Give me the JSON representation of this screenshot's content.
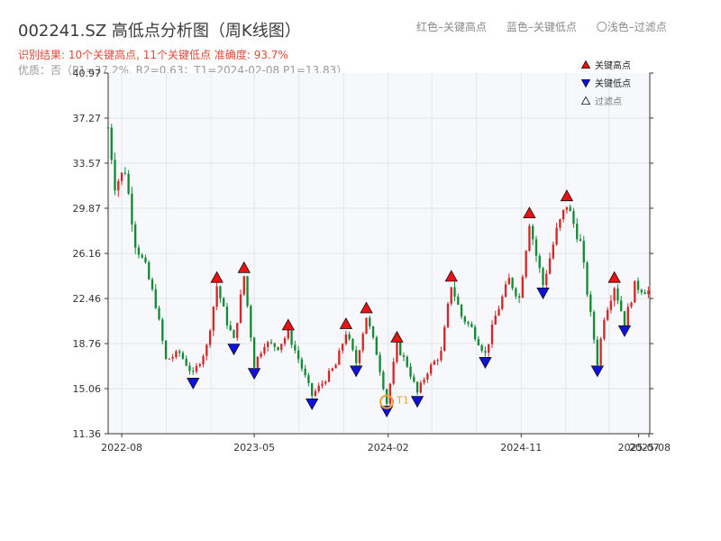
{
  "header": {
    "title": "002241.SZ 高低点分析图（周K线图）",
    "legend_red": "红色–关键高点",
    "legend_blue": "蓝色–关键低点",
    "legend_gray": "〇浅色–过滤点",
    "result_line": "识别结果: 10个关键高点, 11个关键低点  准确度: 93.7%",
    "quality_line": "优质：否（P1=37.2%, R2=0.63；T1=2024-02-08 P1=13.83）"
  },
  "chart_data": {
    "type": "candlestick",
    "title": "002241.SZ 高低点分析图（周K线图）",
    "x_range": [
      "2022-07-04",
      "2025-07-24"
    ],
    "x_ticks": [
      {
        "date": "2022-08-01",
        "label": "2022-08"
      },
      {
        "date": "2023-05-01",
        "label": "2023-05"
      },
      {
        "date": "2024-02-01",
        "label": "2024-02"
      },
      {
        "date": "2024-11-01",
        "label": "2024-11"
      },
      {
        "date": "2025-07-01",
        "label": "2025-07"
      },
      {
        "date": "2025-08-01",
        "label": "2025-08"
      }
    ],
    "ylim": [
      11.36,
      40.97
    ],
    "y_ticks": [
      11.36,
      15.06,
      18.76,
      22.46,
      26.16,
      29.87,
      33.57,
      37.27,
      40.97
    ],
    "grid": true,
    "colors": {
      "up": "#d62728",
      "down": "#138a36",
      "high_marker": "#ee1111",
      "low_marker": "#1111dd",
      "t1_marker": "#f0a030",
      "grid": "#e3e6ea",
      "plot_bg": "#f6f8fb"
    },
    "price_path": [
      [
        "2022-07-04",
        36.5
      ],
      [
        "2022-07-18",
        31.8
      ],
      [
        "2022-08-08",
        33.0
      ],
      [
        "2022-08-29",
        27.0
      ],
      [
        "2022-09-19",
        25.0
      ],
      [
        "2022-10-10",
        22.0
      ],
      [
        "2022-10-31",
        17.4
      ],
      [
        "2022-11-28",
        18.0
      ],
      [
        "2022-12-26",
        16.2
      ],
      [
        "2023-01-23",
        18.5
      ],
      [
        "2023-02-13",
        23.5
      ],
      [
        "2023-03-06",
        20.5
      ],
      [
        "2023-03-20",
        19.0
      ],
      [
        "2023-04-10",
        24.3
      ],
      [
        "2023-05-01",
        17.0
      ],
      [
        "2023-05-22",
        18.8
      ],
      [
        "2023-06-19",
        18.5
      ],
      [
        "2023-07-10",
        19.6
      ],
      [
        "2023-07-31",
        17.5
      ],
      [
        "2023-08-28",
        14.5
      ],
      [
        "2023-09-18",
        15.5
      ],
      [
        "2023-10-16",
        17.0
      ],
      [
        "2023-11-06",
        19.7
      ],
      [
        "2023-11-27",
        17.2
      ],
      [
        "2023-12-18",
        21.0
      ],
      [
        "2024-01-08",
        18.0
      ],
      [
        "2024-01-29",
        13.9
      ],
      [
        "2024-02-19",
        18.6
      ],
      [
        "2024-03-11",
        17.0
      ],
      [
        "2024-04-01",
        14.7
      ],
      [
        "2024-04-22",
        16.5
      ],
      [
        "2024-05-20",
        18.0
      ],
      [
        "2024-06-10",
        23.6
      ],
      [
        "2024-07-01",
        21.0
      ],
      [
        "2024-07-22",
        20.0
      ],
      [
        "2024-08-19",
        17.9
      ],
      [
        "2024-09-09",
        21.0
      ],
      [
        "2024-10-07",
        24.0
      ],
      [
        "2024-10-28",
        22.5
      ],
      [
        "2024-11-18",
        28.8
      ],
      [
        "2024-12-02",
        26.0
      ],
      [
        "2024-12-16",
        23.6
      ],
      [
        "2025-01-13",
        28.0
      ],
      [
        "2025-02-03",
        30.2
      ],
      [
        "2025-03-03",
        27.0
      ],
      [
        "2025-03-17",
        23.0
      ],
      [
        "2025-04-07",
        17.2
      ],
      [
        "2025-04-21",
        21.0
      ],
      [
        "2025-05-12",
        23.5
      ],
      [
        "2025-06-02",
        20.5
      ],
      [
        "2025-06-23",
        23.5
      ],
      [
        "2025-07-24",
        23.0
      ]
    ],
    "key_highs": [
      {
        "date": "2023-02-13",
        "price": 23.5
      },
      {
        "date": "2023-04-10",
        "price": 24.3
      },
      {
        "date": "2023-07-10",
        "price": 19.6
      },
      {
        "date": "2023-11-06",
        "price": 19.7
      },
      {
        "date": "2023-12-18",
        "price": 21.0
      },
      {
        "date": "2024-02-19",
        "price": 18.6
      },
      {
        "date": "2024-06-10",
        "price": 23.6
      },
      {
        "date": "2024-11-18",
        "price": 28.8
      },
      {
        "date": "2025-02-03",
        "price": 30.2
      },
      {
        "date": "2025-05-12",
        "price": 23.5
      }
    ],
    "key_lows": [
      {
        "date": "2022-12-26",
        "price": 16.2
      },
      {
        "date": "2023-03-20",
        "price": 19.0
      },
      {
        "date": "2023-05-01",
        "price": 17.0
      },
      {
        "date": "2023-08-28",
        "price": 14.5
      },
      {
        "date": "2023-11-27",
        "price": 17.2
      },
      {
        "date": "2024-01-29",
        "price": 13.9
      },
      {
        "date": "2024-04-01",
        "price": 14.7
      },
      {
        "date": "2024-08-19",
        "price": 17.9
      },
      {
        "date": "2024-12-16",
        "price": 23.6
      },
      {
        "date": "2025-04-07",
        "price": 17.2
      },
      {
        "date": "2025-06-02",
        "price": 20.5
      }
    ],
    "t1": {
      "date": "2024-01-29",
      "price": 13.9,
      "label": "T1"
    },
    "legend": {
      "position": "top-right",
      "entries": [
        {
          "label": "关键高点",
          "marker": "up-triangle",
          "color": "#ee1111"
        },
        {
          "label": "关键低点",
          "marker": "down-triangle",
          "color": "#1111dd"
        },
        {
          "label": "过滤点",
          "marker": "up-triangle-hollow",
          "color": "#ffffff"
        }
      ]
    }
  }
}
